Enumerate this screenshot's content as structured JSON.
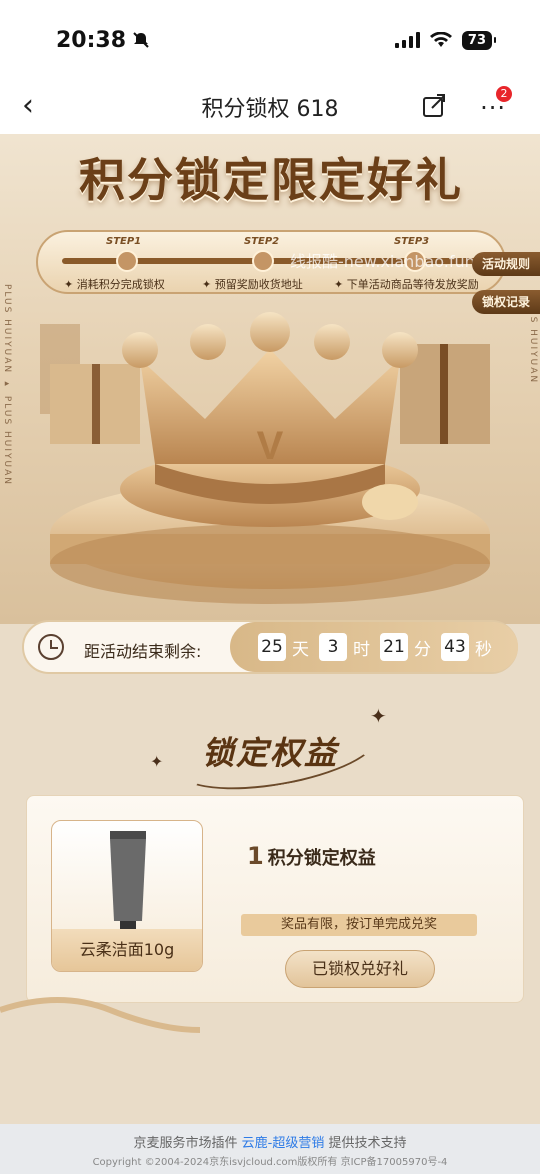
{
  "status": {
    "time": "20:38",
    "battery": "73"
  },
  "nav": {
    "title": "积分锁权 618",
    "badge": "2"
  },
  "hero": {
    "title": "积分锁定限定好礼",
    "side_text": "PLUS HUIYUAN ▸ PLUS HUIYUAN",
    "side_text_right": "PLUS HUIYUAN",
    "steps": [
      {
        "label": "STEP1",
        "text": "✦ 消耗积分完成锁权"
      },
      {
        "label": "STEP2",
        "text": "✦ 预留奖励收货地址"
      },
      {
        "label": "STEP3",
        "text": "✦ 下单活动商品等待发放奖励"
      }
    ],
    "watermark": "线报酷-new.xianbao.fun",
    "rules_btn": "活动规则",
    "records_btn": "锁权记录",
    "crown_letter": "V"
  },
  "timer": {
    "label": "距活动结束剩余:",
    "days": "25",
    "days_unit": "天",
    "hours": "3",
    "hours_unit": "时",
    "minutes": "21",
    "minutes_unit": "分",
    "seconds": "43",
    "seconds_unit": "秒"
  },
  "section": {
    "title": "锁定权益"
  },
  "card": {
    "product_name": "云柔洁面10g",
    "points_num": "1",
    "points_text": "积分锁定权益",
    "note": "奖品有限，按订单完成兑奖",
    "button": "已锁权兑好礼"
  },
  "footer": {
    "line1_a": "京麦服务市场插件",
    "line1_link": "云鹿-超级营销",
    "line1_b": "提供技术支持",
    "line2": "Copyright ©2004-2024京东isvjcloud.com版权所有 京ICP备17005970号-4"
  },
  "colors": {
    "accent": "#6b3f18",
    "gold": "#d8b888",
    "link": "#2e7be6",
    "badge": "#e8262b"
  }
}
